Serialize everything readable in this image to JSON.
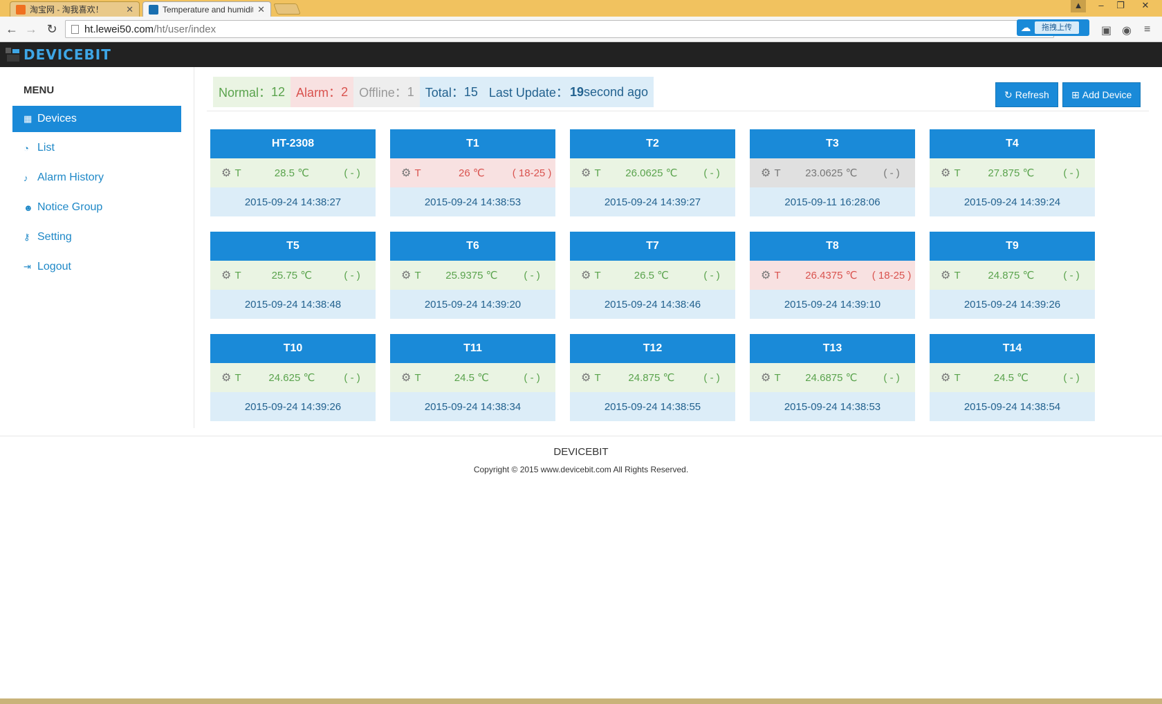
{
  "browser": {
    "tabs": [
      {
        "title": "淘宝网 - 淘我喜欢！",
        "favicon_color": "#f07020"
      },
      {
        "title": "Temperature and humidit",
        "favicon_color": "#1a6fb0"
      }
    ],
    "url_host": "ht.lewei50.com",
    "url_path": "/ht/user/index",
    "upload_label": "拖拽上传"
  },
  "site": {
    "logo_text": "DEVICEBIT"
  },
  "sidebar": {
    "title": "MENU",
    "items": [
      {
        "label": "Devices",
        "icon": "grid-icon",
        "glyph": "▦",
        "active": true
      },
      {
        "label": "List",
        "icon": "dashboard-icon",
        "glyph": "◔"
      },
      {
        "label": "Alarm History",
        "icon": "bell-icon",
        "glyph": "🔔"
      },
      {
        "label": "Notice Group",
        "icon": "users-icon",
        "glyph": "👥"
      },
      {
        "label": "Setting",
        "icon": "key-icon",
        "glyph": "🔧"
      },
      {
        "label": "Logout",
        "icon": "sign-out-icon",
        "glyph": "⇥"
      }
    ]
  },
  "summary": {
    "normal_label": "Normal：",
    "normal_count": "12",
    "alarm_label": "Alarm：",
    "alarm_count": "2",
    "offline_label": "Offline：",
    "offline_count": "1",
    "total_label": "Total：",
    "total_count": "15",
    "update_label": "Last Update：",
    "update_value": "19",
    "update_suffix": "second ago"
  },
  "actions": {
    "refresh_label": "Refresh",
    "add_label": "Add Device"
  },
  "devices": [
    {
      "name": "HT-2308",
      "sensor": "T",
      "value": "28.5 ℃",
      "range": "( - )",
      "status": "ok",
      "time": "2015-09-24 14:38:27"
    },
    {
      "name": "T1",
      "sensor": "T",
      "value": "26 ℃",
      "range": "( 18-25 )",
      "status": "alarm",
      "time": "2015-09-24 14:38:53"
    },
    {
      "name": "T2",
      "sensor": "T",
      "value": "26.0625 ℃",
      "range": "( - )",
      "status": "ok",
      "time": "2015-09-24 14:39:27"
    },
    {
      "name": "T3",
      "sensor": "T",
      "value": "23.0625 ℃",
      "range": "( - )",
      "status": "offline",
      "time": "2015-09-11 16:28:06"
    },
    {
      "name": "T4",
      "sensor": "T",
      "value": "27.875 ℃",
      "range": "( - )",
      "status": "ok",
      "time": "2015-09-24 14:39:24"
    },
    {
      "name": "T5",
      "sensor": "T",
      "value": "25.75 ℃",
      "range": "( - )",
      "status": "ok",
      "time": "2015-09-24 14:38:48"
    },
    {
      "name": "T6",
      "sensor": "T",
      "value": "25.9375 ℃",
      "range": "( - )",
      "status": "ok",
      "time": "2015-09-24 14:39:20"
    },
    {
      "name": "T7",
      "sensor": "T",
      "value": "26.5 ℃",
      "range": "( - )",
      "status": "ok",
      "time": "2015-09-24 14:38:46"
    },
    {
      "name": "T8",
      "sensor": "T",
      "value": "26.4375 ℃",
      "range": "( 18-25 )",
      "status": "alarm",
      "time": "2015-09-24 14:39:10"
    },
    {
      "name": "T9",
      "sensor": "T",
      "value": "24.875 ℃",
      "range": "( - )",
      "status": "ok",
      "time": "2015-09-24 14:39:26"
    },
    {
      "name": "T10",
      "sensor": "T",
      "value": "24.625 ℃",
      "range": "( - )",
      "status": "ok",
      "time": "2015-09-24 14:39:26"
    },
    {
      "name": "T11",
      "sensor": "T",
      "value": "24.5 ℃",
      "range": "( - )",
      "status": "ok",
      "time": "2015-09-24 14:38:34"
    },
    {
      "name": "T12",
      "sensor": "T",
      "value": "24.875 ℃",
      "range": "( - )",
      "status": "ok",
      "time": "2015-09-24 14:38:55"
    },
    {
      "name": "T13",
      "sensor": "T",
      "value": "24.6875 ℃",
      "range": "( - )",
      "status": "ok",
      "time": "2015-09-24 14:38:53"
    },
    {
      "name": "T14",
      "sensor": "T",
      "value": "24.5 ℃",
      "range": "( - )",
      "status": "ok",
      "time": "2015-09-24 14:38:54"
    }
  ],
  "footer": {
    "brand": "DEVICEBIT",
    "copyright": "Copyright © 2015 www.devicebit.com All Rights Reserved."
  },
  "colors": {
    "primary": "#1a8ad8",
    "ok": "#5aa34d",
    "alarm": "#d9534f",
    "offline": "#999999"
  }
}
